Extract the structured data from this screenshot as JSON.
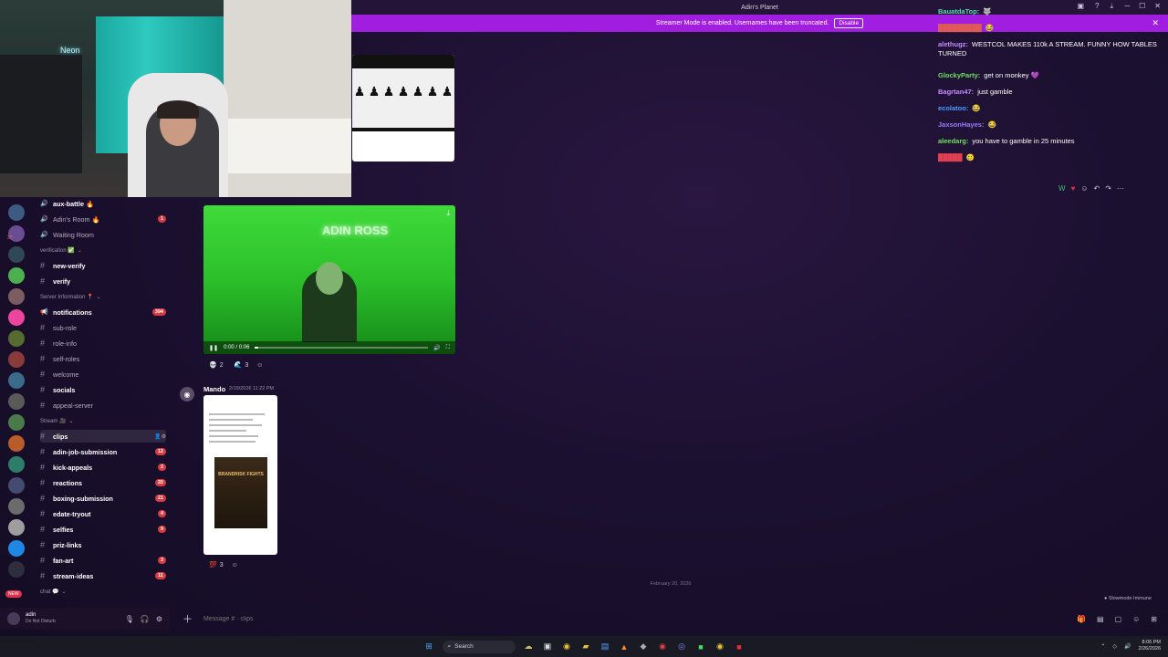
{
  "window": {
    "title": "Adin's Planet"
  },
  "banner": {
    "text": "Streamer Mode is enabled. Usernames have been truncated.",
    "disable_label": "Disable",
    "close": "✕"
  },
  "webcam": {
    "neon_text": "Neon"
  },
  "servers": [
    {
      "color": "#3d5a80",
      "badge": ""
    },
    {
      "color": "#6a4c93",
      "badge": "37"
    },
    {
      "color": "#2f4858",
      "badge": ""
    },
    {
      "color": "#4caf50",
      "badge": ""
    },
    {
      "color": "#7a5c61",
      "badge": ""
    },
    {
      "color": "#eb459e",
      "badge": ""
    },
    {
      "color": "#556b2f",
      "badge": ""
    },
    {
      "color": "#8b3a3a",
      "badge": ""
    },
    {
      "color": "#3a6b8b",
      "badge": ""
    },
    {
      "color": "#5a5a5a",
      "badge": ""
    },
    {
      "color": "#4a7a4a",
      "badge": ""
    },
    {
      "color": "#b85c2c",
      "badge": ""
    },
    {
      "color": "#2e7d6a",
      "badge": ""
    },
    {
      "color": "#444b6e",
      "badge": ""
    },
    {
      "color": "#6b6b6b",
      "badge": ""
    },
    {
      "color": "#9e9e9e",
      "badge": ""
    },
    {
      "color": "#1e88e5",
      "badge": ""
    },
    {
      "color": "#2e2e3e",
      "badge": ""
    }
  ],
  "new_pill": "NEW",
  "channels": [
    {
      "type": "voice",
      "label": "aux-battle 🔥",
      "badge": "",
      "unread": true
    },
    {
      "type": "voice",
      "label": "Adin's Room 🔥",
      "badge": "1",
      "unread": false
    },
    {
      "type": "voice",
      "label": "Waiting Room",
      "badge": "",
      "unread": false
    },
    {
      "type": "category",
      "label": "verification ✅"
    },
    {
      "type": "text",
      "label": "new-verify",
      "badge": "",
      "unread": true
    },
    {
      "type": "text",
      "label": "verify",
      "badge": "",
      "unread": true
    },
    {
      "type": "category",
      "label": "Server Information 📍"
    },
    {
      "type": "announce",
      "label": "notifications",
      "badge": "394",
      "unread": true
    },
    {
      "type": "text",
      "label": "sub-role",
      "badge": "",
      "unread": false
    },
    {
      "type": "text",
      "label": "role-info",
      "badge": "",
      "unread": false
    },
    {
      "type": "text",
      "label": "self-roles",
      "badge": "",
      "unread": false
    },
    {
      "type": "text",
      "label": "welcome",
      "badge": "",
      "unread": false
    },
    {
      "type": "text",
      "label": "socials",
      "badge": "",
      "unread": true
    },
    {
      "type": "text",
      "label": "appeal-server",
      "badge": "",
      "unread": false
    },
    {
      "type": "category",
      "label": "Stream 🎥"
    },
    {
      "type": "text",
      "label": "clips",
      "badge": "",
      "unread": true,
      "active": true
    },
    {
      "type": "text",
      "label": "adin-job-submission",
      "badge": "12",
      "unread": true
    },
    {
      "type": "text",
      "label": "kick-appeals",
      "badge": "2",
      "unread": true
    },
    {
      "type": "text",
      "label": "reactions",
      "badge": "20",
      "unread": true
    },
    {
      "type": "text",
      "label": "boxing-submission",
      "badge": "21",
      "unread": true
    },
    {
      "type": "text",
      "label": "edate-tryout",
      "badge": "4",
      "unread": true
    },
    {
      "type": "text",
      "label": "selfies",
      "badge": "9",
      "unread": true
    },
    {
      "type": "text",
      "label": "priz-links",
      "badge": "",
      "unread": true
    },
    {
      "type": "text",
      "label": "fan-art",
      "badge": "3",
      "unread": true
    },
    {
      "type": "text",
      "label": "stream-ideas",
      "badge": "11",
      "unread": true
    },
    {
      "type": "category",
      "label": "chat 💬"
    }
  ],
  "user": {
    "name": "adin",
    "status": "Do Not Disturb"
  },
  "video": {
    "neon": "ADIN ROSS",
    "time": "0:00 / 0:06",
    "progress": 0.02
  },
  "video_reactions": [
    {
      "emoji": "💀",
      "count": "2"
    },
    {
      "emoji": "🌊",
      "count": "3"
    }
  ],
  "mando": {
    "author": "Mando",
    "time": "2/19/2026 11:22 PM",
    "avatar": "◉",
    "poster_title": "BRANDRISK FIGHTS"
  },
  "mando_reactions": [
    {
      "emoji": "💯",
      "count": "3"
    }
  ],
  "date_divider": "February 20, 2026",
  "slowmode": "● Slowmode Immune",
  "composer": {
    "placeholder": "Message # · clips"
  },
  "chat": [
    {
      "user": "BauatdaTop:",
      "user_color": "#52e0b0",
      "text": "🐺"
    },
    {
      "user": "█████████",
      "user_color": "#e05a5a",
      "text": "😂"
    },
    {
      "user": "alethugz:",
      "user_color": "#c48cff",
      "text": "WESTCOL MAKES 110k A STREAM. FUNNY HOW TABLES TURNED"
    },
    {
      "user": "GlockyParty:",
      "user_color": "#6ee060",
      "text": "get on monkey 💜"
    },
    {
      "user": "Bagrtan47:",
      "user_color": "#c48cff",
      "text": "just gamble"
    },
    {
      "user": "ecolatoo:",
      "user_color": "#4a9eff",
      "text": "😂"
    },
    {
      "user": "JaxsonHayes:",
      "user_color": "#9b7bff",
      "text": "😂"
    },
    {
      "user": "aleedarg:",
      "user_color": "#6ee060",
      "text": "you have to gamble in 25 minutes"
    },
    {
      "user": "█████",
      "user_color": "#e04050",
      "text": "🥲"
    }
  ],
  "taskbar": {
    "search": "Search",
    "time": "8:06 PM",
    "date": "2/26/2026"
  },
  "colors": {
    "banner": "#a11ee0",
    "badge": "#d83a42",
    "accent_bg": "#1b1030"
  }
}
